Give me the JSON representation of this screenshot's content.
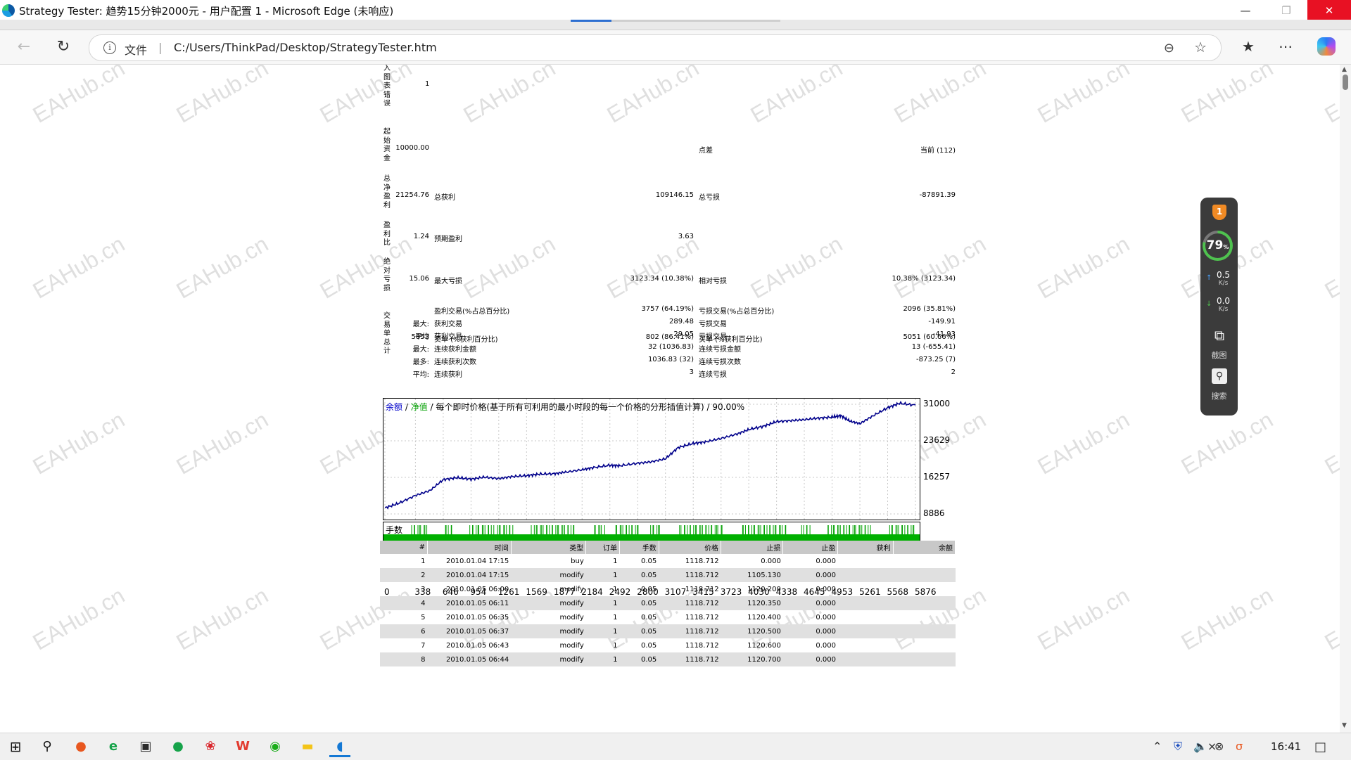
{
  "browser": {
    "window_title": "Strategy Tester: 趋势15分钟2000元 - 用户配置 1 - Microsoft Edge (未响应)",
    "file_label": "文件",
    "url": "C:/Users/ThinkPad/Desktop/StrategyTester.htm"
  },
  "report": {
    "input_chart_errors": {
      "label": "入图表错误",
      "value": "1"
    },
    "initial_deposit": {
      "label": "起始资金",
      "value": "10000.00",
      "spread_label": "点差",
      "spread_value": "当前 (112)"
    },
    "net_profit": {
      "label": "总净盈利",
      "value": "21254.76",
      "gross_profit_label": "总获利",
      "gross_profit": "109146.15",
      "gross_loss_label": "总亏损",
      "gross_loss": "-87891.39"
    },
    "profit_factor": {
      "label": "盈利比",
      "value": "1.24",
      "expected_payoff_label": "预期盈利",
      "expected_payoff": "3.63"
    },
    "absolute_drawdown": {
      "label": "绝对亏损",
      "value": "15.06",
      "max_dd_label": "最大亏损",
      "max_dd": "3123.34 (10.38%)",
      "rel_dd_label": "相对亏损",
      "rel_dd": "10.38% (3123.34)"
    },
    "total_trades": {
      "label": "交易单总计",
      "value": "5853",
      "short_label": "卖单 (%获利百分比)",
      "short_value": "802 (86.41%)",
      "long_label": "买单 (%获利百分比)",
      "long_value": "5051 (60.66%)"
    },
    "rows": [
      {
        "prefix": "",
        "a_label": "盈利交易(%占总百分比)",
        "a_value": "3757 (64.19%)",
        "b_label": "亏损交易(%占总百分比)",
        "b_value": "2096 (35.81%)"
      },
      {
        "prefix": "最大:",
        "a_label": "获利交易",
        "a_value": "289.48",
        "b_label": "亏损交易",
        "b_value": "-149.91"
      },
      {
        "prefix": "平均",
        "a_label": "获利交易",
        "a_value": "29.05",
        "b_label": "亏损交易",
        "b_value": "-41.93"
      },
      {
        "prefix": "最大:",
        "a_label": "连续获利金额",
        "a_value": "32 (1036.83)",
        "b_label": "连续亏损金额",
        "b_value": "13 (-655.41)"
      },
      {
        "prefix": "最多:",
        "a_label": "连续获利次数",
        "a_value": "1036.83 (32)",
        "b_label": "连续亏损次数",
        "b_value": "-873.25 (7)"
      },
      {
        "prefix": "平均:",
        "a_label": "连续获利",
        "a_value": "3",
        "b_label": "连续亏损",
        "b_value": "2"
      }
    ]
  },
  "chart_legend": {
    "balance": "余额",
    "slash1": " / ",
    "equity": "净值",
    "rest": " / 每个即时价格(基于所有可利用的最小时段的每一个价格的分形插值计算) / 90.00%"
  },
  "lots_label": "手数",
  "chart_data": {
    "type": "line",
    "title": "",
    "xlabel": "",
    "ylabel": "",
    "x_ticks": [
      "0",
      "338",
      "646",
      "954",
      "1261",
      "1569",
      "1877",
      "2184",
      "2492",
      "2800",
      "3107",
      "3415",
      "3723",
      "4030",
      "4338",
      "4645",
      "4953",
      "5261",
      "5568",
      "5876"
    ],
    "y_ticks": [
      "31000",
      "23629",
      "16257",
      "8886"
    ],
    "ylim": [
      8886,
      31000
    ],
    "xlim": [
      0,
      5876
    ],
    "grid": true,
    "series": [
      {
        "name": "余额",
        "color": "#00008b",
        "x": [
          0,
          150,
          338,
          500,
          646,
          800,
          954,
          1100,
          1261,
          1400,
          1569,
          1700,
          1877,
          2000,
          2184,
          2300,
          2492,
          2600,
          2800,
          2950,
          3107,
          3250,
          3415,
          3550,
          3723,
          3900,
          4030,
          4200,
          4338,
          4500,
          4645,
          4800,
          4953,
          5050,
          5150,
          5261,
          5400,
          5568,
          5700,
          5876
        ],
        "y": [
          10100,
          11000,
          12600,
          13600,
          15800,
          16200,
          15900,
          16300,
          16000,
          16400,
          16600,
          16900,
          17000,
          17300,
          17800,
          18200,
          18700,
          18600,
          19100,
          19400,
          20000,
          22300,
          23100,
          23400,
          24100,
          25000,
          25900,
          26600,
          27500,
          27700,
          27900,
          28200,
          28400,
          28700,
          27600,
          27100,
          28600,
          30300,
          31200,
          30800
        ]
      },
      {
        "name": "净值",
        "color": "#00a000",
        "x": [
          0,
          5876
        ],
        "y": [
          10100,
          30800
        ]
      }
    ]
  },
  "orders": {
    "headers": [
      "#",
      "时间",
      "类型",
      "订单",
      "手数",
      "价格",
      "止损",
      "止盈",
      "获利",
      "余额"
    ],
    "rows": [
      [
        "1",
        "2010.01.04 17:15",
        "buy",
        "1",
        "0.05",
        "1118.712",
        "0.000",
        "0.000",
        "",
        ""
      ],
      [
        "2",
        "2010.01.04 17:15",
        "modify",
        "1",
        "0.05",
        "1118.712",
        "1105.130",
        "0.000",
        "",
        ""
      ],
      [
        "3",
        "2010.01.05 06:00",
        "modify",
        "1",
        "0.05",
        "1118.712",
        "1120.200",
        "0.000",
        "",
        ""
      ],
      [
        "4",
        "2010.01.05 06:11",
        "modify",
        "1",
        "0.05",
        "1118.712",
        "1120.350",
        "0.000",
        "",
        ""
      ],
      [
        "5",
        "2010.01.05 06:35",
        "modify",
        "1",
        "0.05",
        "1118.712",
        "1120.400",
        "0.000",
        "",
        ""
      ],
      [
        "6",
        "2010.01.05 06:37",
        "modify",
        "1",
        "0.05",
        "1118.712",
        "1120.500",
        "0.000",
        "",
        ""
      ],
      [
        "7",
        "2010.01.05 06:43",
        "modify",
        "1",
        "0.05",
        "1118.712",
        "1120.600",
        "0.000",
        "",
        ""
      ],
      [
        "8",
        "2010.01.05 06:44",
        "modify",
        "1",
        "0.05",
        "1118.712",
        "1120.700",
        "0.000",
        "",
        ""
      ]
    ]
  },
  "widget": {
    "badge": "1",
    "score": "79",
    "score_unit": "%",
    "up_speed": "0.5",
    "down_speed": "0.0",
    "speed_unit": "K/s",
    "screenshot_label": "截图",
    "search_label": "搜索"
  },
  "watermark": "EAHub.cn",
  "taskbar": {
    "time": "16:41"
  }
}
